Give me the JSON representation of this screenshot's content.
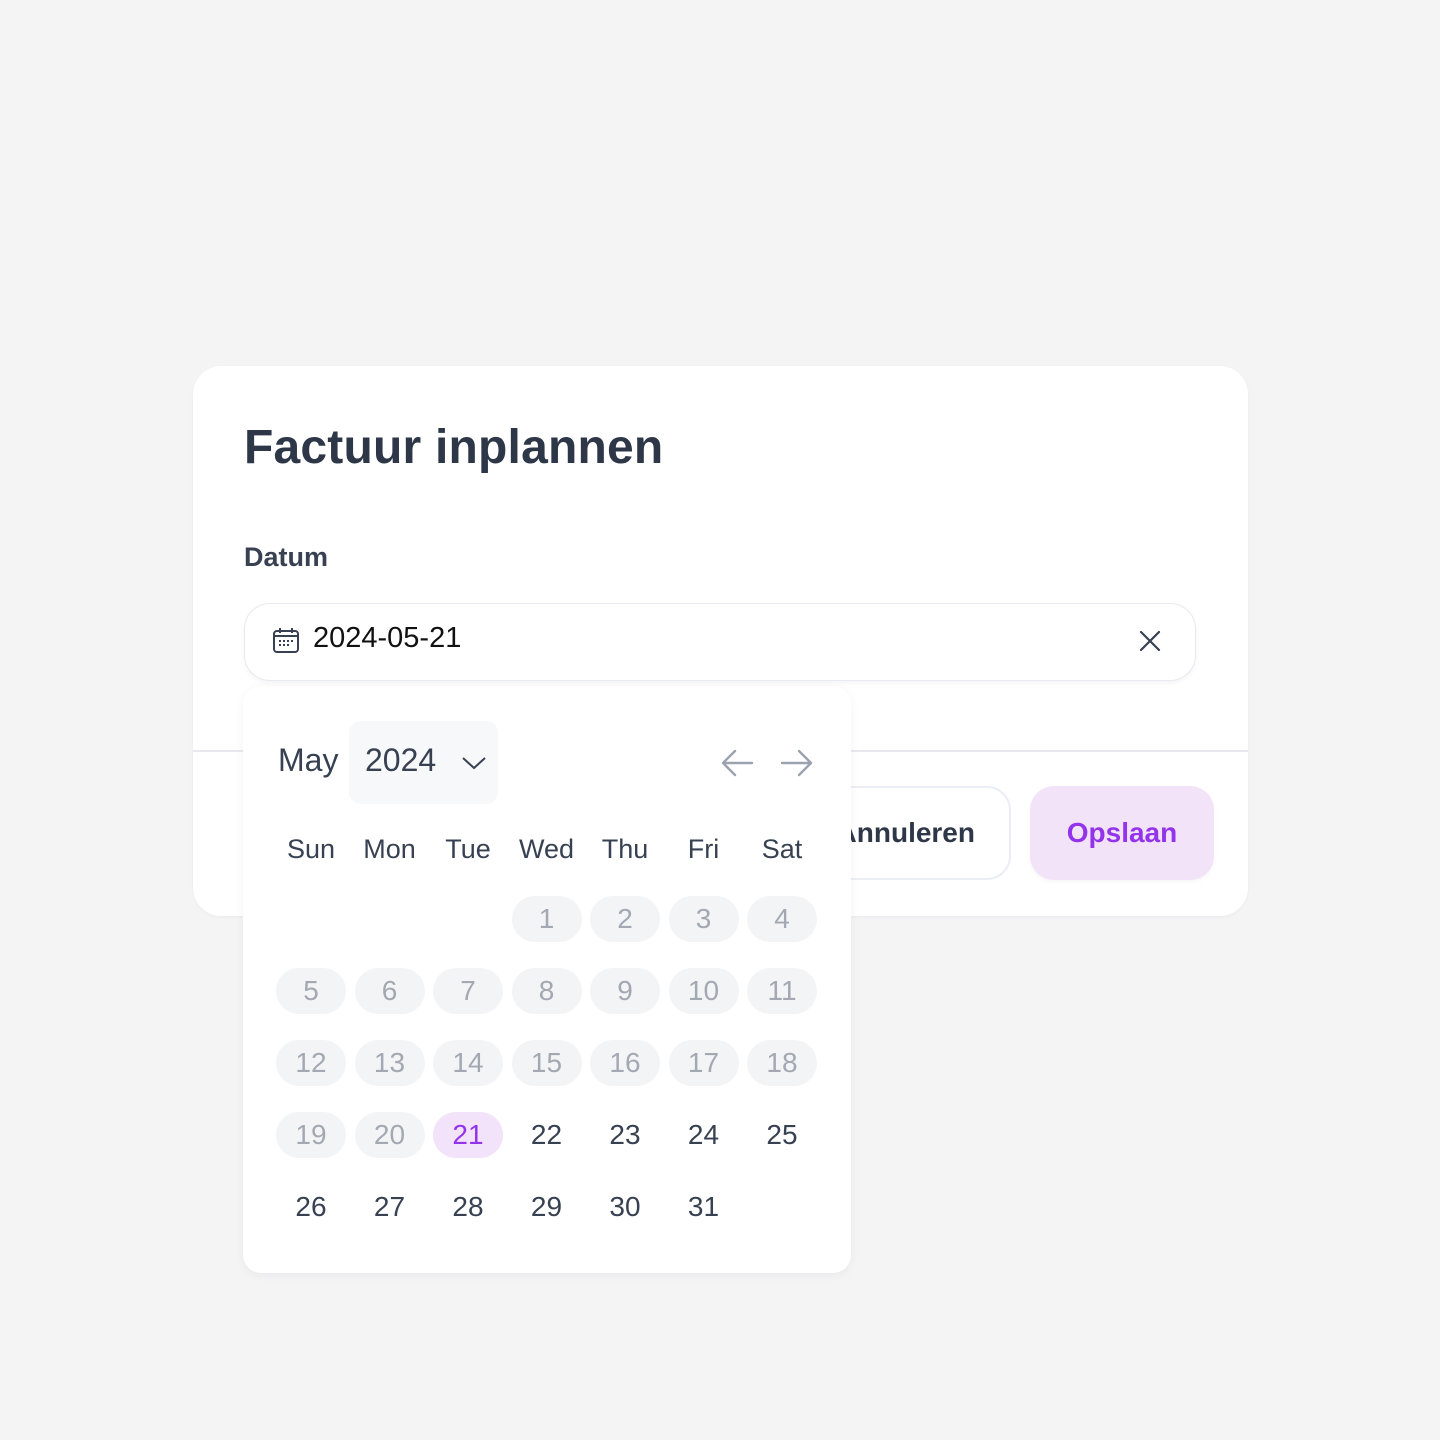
{
  "dialog": {
    "title": "Factuur inplannen",
    "date_label": "Datum",
    "date_value": "2024-05-21",
    "cancel_label": "Annuleren",
    "save_label": "Opslaan"
  },
  "calendar": {
    "month": "May",
    "year": "2024",
    "weekdays": [
      "Sun",
      "Mon",
      "Tue",
      "Wed",
      "Thu",
      "Fri",
      "Sat"
    ],
    "first_weekday_index": 3,
    "days_in_month": 31,
    "disabled_through": 20,
    "selected_day": 21
  },
  "colors": {
    "accent": "#9333ea",
    "accent_bg": "#f3e3fa"
  }
}
